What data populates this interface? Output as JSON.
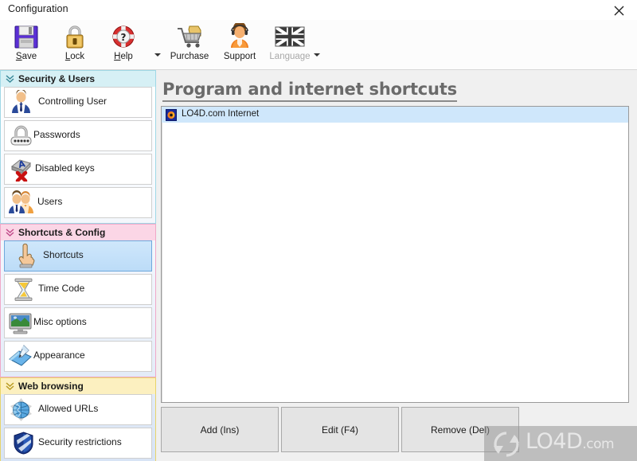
{
  "window": {
    "title": "Configuration",
    "close_label": "×",
    "close_icon": "close-icon"
  },
  "toolbar": {
    "buttons": [
      {
        "id": "save",
        "label": "Save",
        "accel": "S",
        "icon": "floppy-disk-icon",
        "disabled": false,
        "dropdown": false
      },
      {
        "id": "lock",
        "label": "Lock",
        "accel": "L",
        "icon": "padlock-icon",
        "disabled": false,
        "dropdown": false
      },
      {
        "id": "help",
        "label": "Help",
        "accel": "H",
        "icon": "life-ring-question-icon",
        "disabled": false,
        "dropdown": true
      },
      {
        "id": "purchase",
        "label": "Purchase",
        "accel": "",
        "icon": "shopping-cart-icon",
        "disabled": false,
        "dropdown": false
      },
      {
        "id": "support",
        "label": "Support",
        "accel": "",
        "icon": "headset-person-icon",
        "disabled": false,
        "dropdown": false
      },
      {
        "id": "language",
        "label": "Language",
        "accel": "",
        "icon": "uk-flag-icon",
        "disabled": true,
        "dropdown": true
      }
    ]
  },
  "sidebar": {
    "groups": [
      {
        "id": "security-users",
        "title": "Security & Users",
        "color": "blue",
        "header_bg": "#d6f0f5",
        "items": [
          {
            "id": "controlling-user",
            "label": "Controlling User",
            "icon": "person-blue-suit-icon",
            "selected": false
          },
          {
            "id": "passwords",
            "label": "Passwords",
            "icon": "padlock-dots-icon",
            "selected": false
          },
          {
            "id": "disabled-keys",
            "label": "Disabled keys",
            "icon": "key-cross-icon",
            "selected": false
          },
          {
            "id": "users",
            "label": "Users",
            "icon": "two-people-icon",
            "selected": false
          }
        ]
      },
      {
        "id": "shortcuts-config",
        "title": "Shortcuts & Config",
        "color": "pink",
        "header_bg": "#fbd6e6",
        "items": [
          {
            "id": "shortcuts",
            "label": "Shortcuts",
            "icon": "pointing-hand-icon",
            "selected": true
          },
          {
            "id": "time-code",
            "label": "Time Code",
            "icon": "hourglass-icon",
            "selected": false
          },
          {
            "id": "misc-options",
            "label": "Misc options",
            "icon": "monitor-icon",
            "selected": false
          },
          {
            "id": "appearance",
            "label": "Appearance",
            "icon": "book-pen-icon",
            "selected": false
          }
        ]
      },
      {
        "id": "web-browsing",
        "title": "Web browsing",
        "color": "yellow",
        "header_bg": "#fcf0c0",
        "items": [
          {
            "id": "allowed-urls",
            "label": "Allowed URLs",
            "icon": "globe-icon",
            "selected": false
          },
          {
            "id": "security-restrictions",
            "label": "Security restrictions",
            "icon": "shield-icon",
            "selected": false
          }
        ]
      }
    ]
  },
  "main": {
    "page_title": "Program and internet shortcuts",
    "list": {
      "rows": [
        {
          "label": "LO4D.com Internet",
          "icon": "shortcut-file-icon",
          "selected": true
        }
      ]
    },
    "buttons": [
      {
        "id": "add",
        "label": "Add (Ins)"
      },
      {
        "id": "edit",
        "label": "Edit (F4)"
      },
      {
        "id": "remove",
        "label": "Remove (Del)"
      }
    ]
  },
  "watermark": {
    "text": "LO4D",
    "suffix": ".com",
    "logo_icon": "recycle-arrows-icon"
  }
}
